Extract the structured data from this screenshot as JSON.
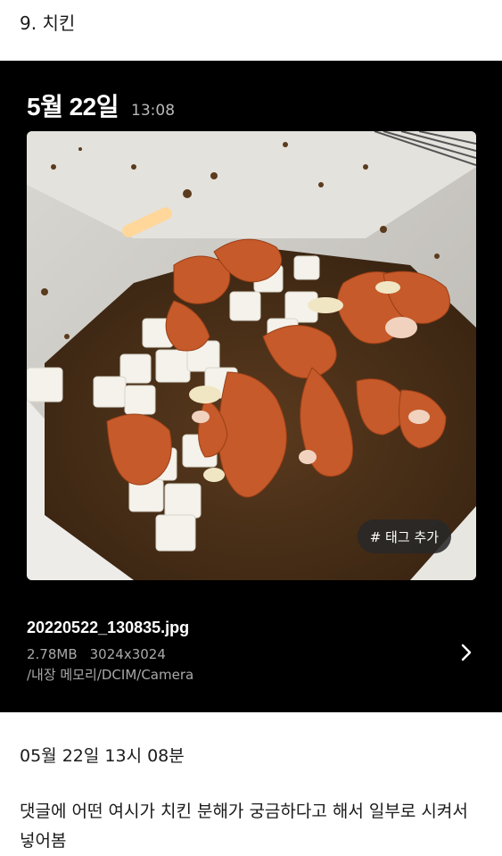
{
  "post": {
    "section_title": "9. 치킨",
    "timestamp_text": "05월 22일 13시 08분",
    "body": "댓글에 어떤 여시가 치킨 분해가 궁금하다고 해서 일부로 시켜서 넣어봄"
  },
  "gallery": {
    "date": "5월 22일",
    "time": "13:08",
    "photo_description": "food waste processor bin with fried chicken pieces, radish cubes and brown soil",
    "tag_button_label": "# 태그 추가",
    "file_name": "20220522_130835.jpg",
    "file_size": "2.78MB",
    "resolution": "3024x3024",
    "path": "/내장 메모리/DCIM/Camera",
    "details_icon": "chevron-right-icon",
    "colors": {
      "card_background": "#000000",
      "secondary_text": "#a9a9a9"
    }
  }
}
